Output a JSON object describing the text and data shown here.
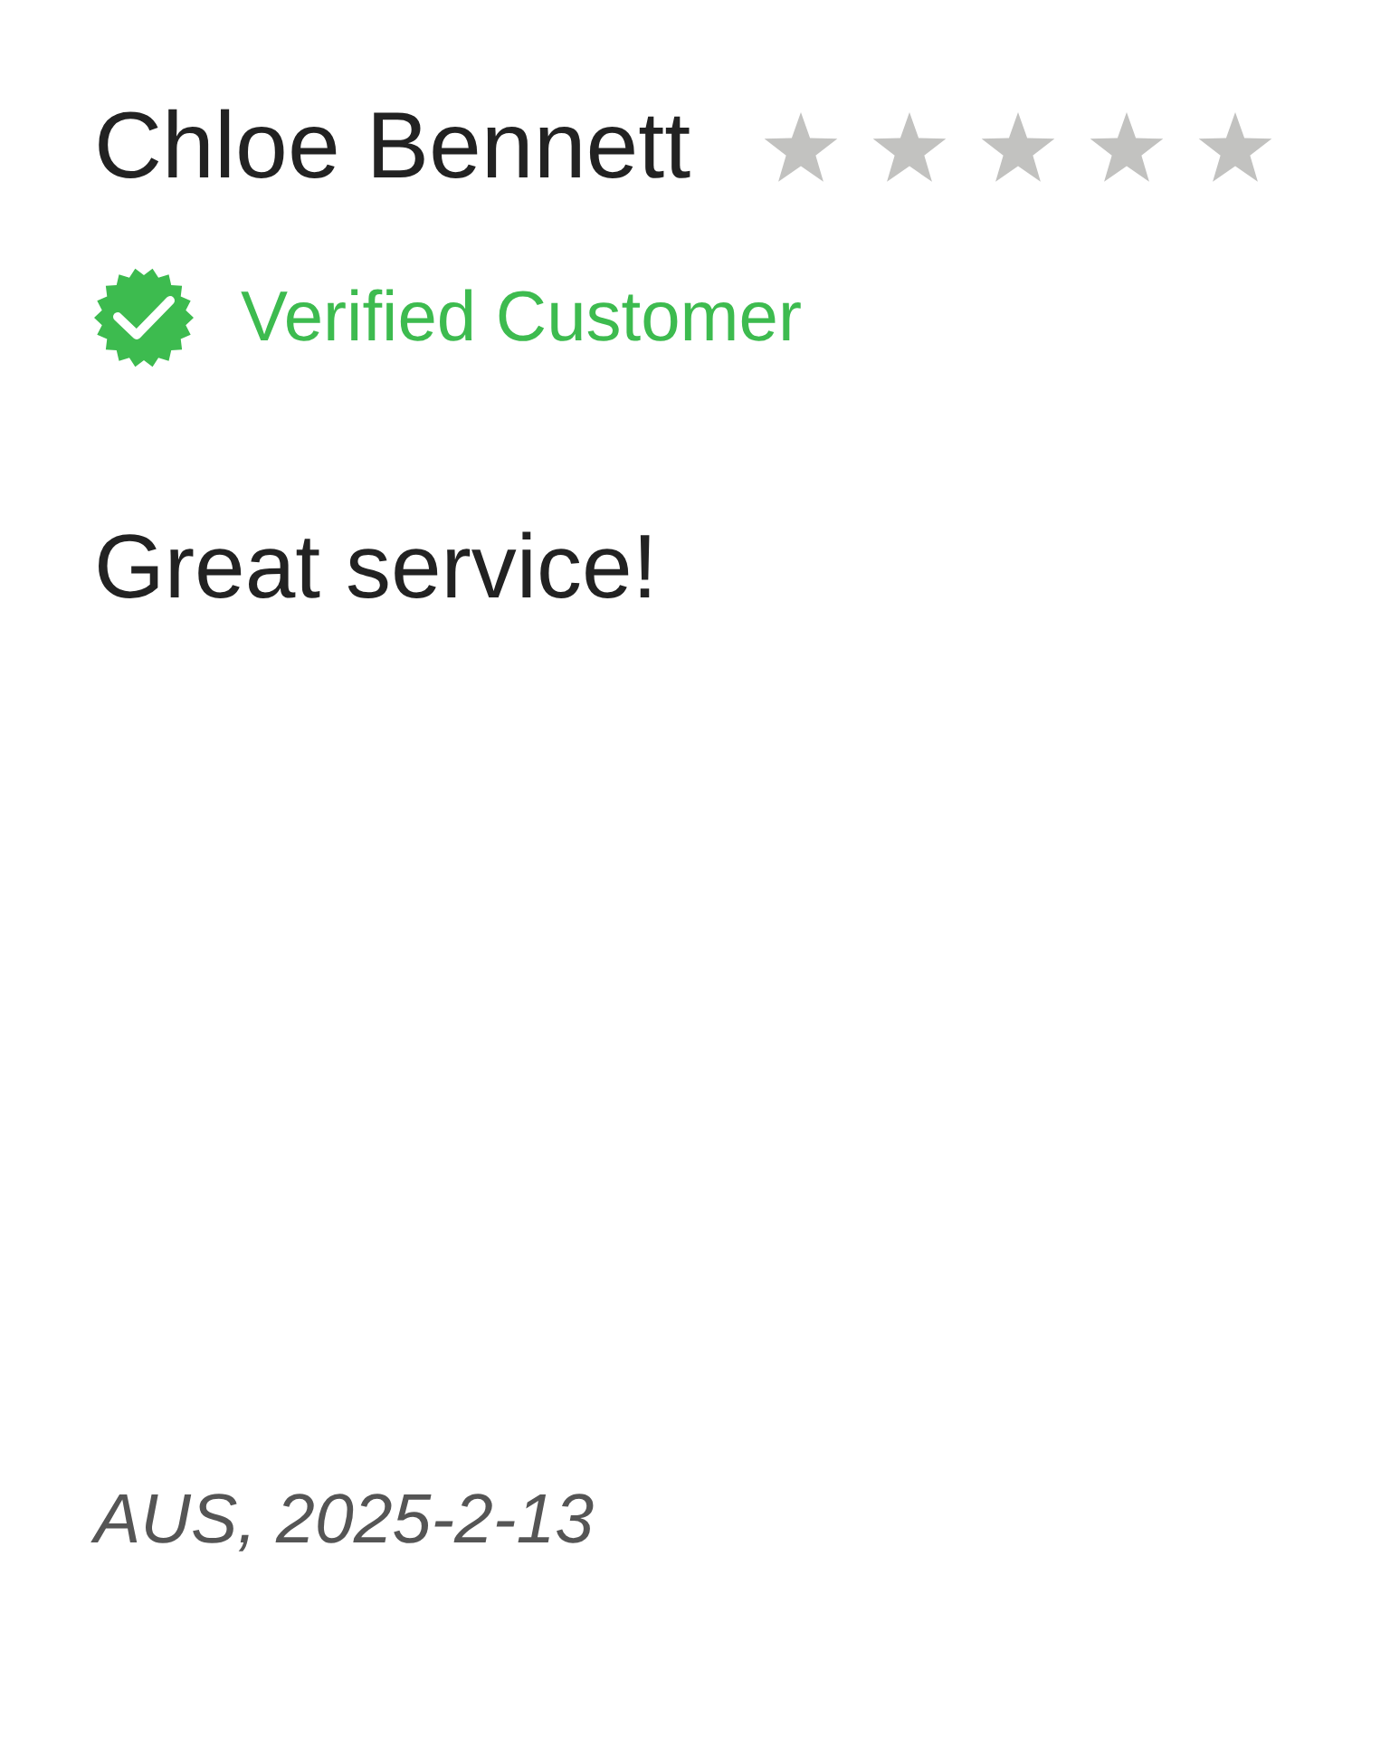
{
  "review": {
    "reviewer": "Chloe Bennett",
    "stars": 0,
    "badge": {
      "label": "Verified Customer"
    },
    "title": "Great service!",
    "location_date": "AUS, 2025-2-13"
  }
}
